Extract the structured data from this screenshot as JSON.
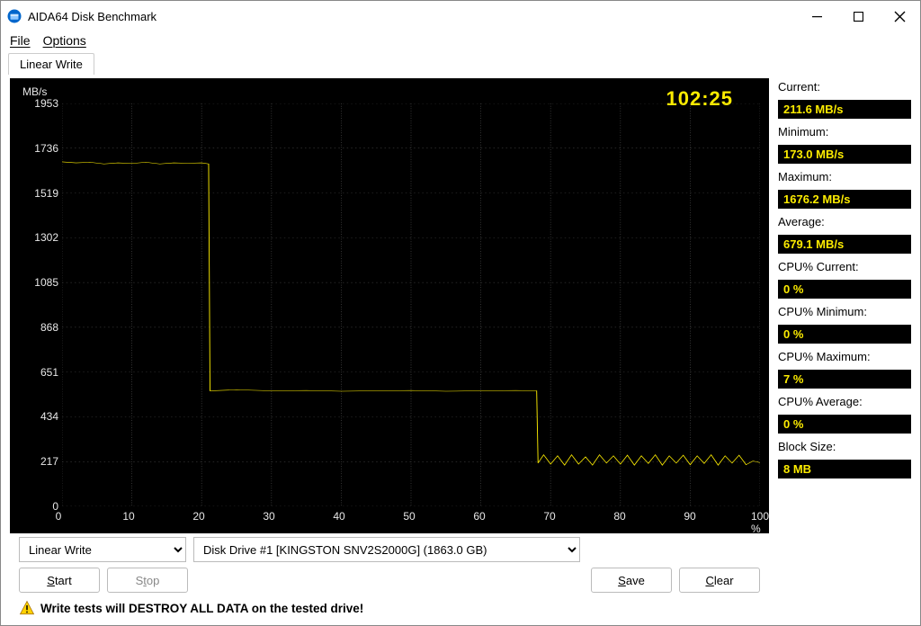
{
  "window": {
    "title": "AIDA64 Disk Benchmark"
  },
  "menu": {
    "file": "File",
    "options": "Options"
  },
  "tabs": {
    "active": "Linear Write"
  },
  "chart_data": {
    "type": "line",
    "ylabel": "MB/s",
    "xlabel_suffix": "%",
    "timer": "102:25",
    "y_ticks": [
      0,
      217,
      434,
      651,
      868,
      1085,
      1302,
      1519,
      1736,
      1953
    ],
    "x_ticks": [
      0,
      10,
      20,
      30,
      40,
      50,
      60,
      70,
      80,
      90,
      100
    ],
    "ylim": [
      0,
      1953
    ],
    "xlim": [
      0,
      100
    ],
    "series": [
      {
        "name": "write-speed",
        "data": [
          [
            0,
            1670
          ],
          [
            2,
            1665
          ],
          [
            4,
            1668
          ],
          [
            6,
            1660
          ],
          [
            8,
            1665
          ],
          [
            10,
            1662
          ],
          [
            12,
            1668
          ],
          [
            14,
            1660
          ],
          [
            16,
            1665
          ],
          [
            18,
            1663
          ],
          [
            20,
            1665
          ],
          [
            21,
            1660
          ],
          [
            21.2,
            560
          ],
          [
            25,
            565
          ],
          [
            30,
            560
          ],
          [
            35,
            562
          ],
          [
            40,
            558
          ],
          [
            45,
            560
          ],
          [
            50,
            562
          ],
          [
            55,
            558
          ],
          [
            60,
            560
          ],
          [
            65,
            562
          ],
          [
            68,
            560
          ],
          [
            68.2,
            210
          ],
          [
            69,
            250
          ],
          [
            70,
            205
          ],
          [
            71,
            245
          ],
          [
            72,
            200
          ],
          [
            73,
            250
          ],
          [
            74,
            205
          ],
          [
            75,
            240
          ],
          [
            76,
            200
          ],
          [
            77,
            250
          ],
          [
            78,
            210
          ],
          [
            79,
            245
          ],
          [
            80,
            205
          ],
          [
            81,
            248
          ],
          [
            82,
            200
          ],
          [
            83,
            245
          ],
          [
            84,
            208
          ],
          [
            85,
            250
          ],
          [
            86,
            200
          ],
          [
            87,
            245
          ],
          [
            88,
            210
          ],
          [
            89,
            248
          ],
          [
            90,
            202
          ],
          [
            91,
            245
          ],
          [
            92,
            208
          ],
          [
            93,
            250
          ],
          [
            94,
            200
          ],
          [
            95,
            245
          ],
          [
            96,
            210
          ],
          [
            97,
            248
          ],
          [
            98,
            202
          ],
          [
            99,
            220
          ],
          [
            100,
            212
          ]
        ]
      }
    ]
  },
  "stats": {
    "current_label": "Current:",
    "current_value": "211.6 MB/s",
    "minimum_label": "Minimum:",
    "minimum_value": "173.0 MB/s",
    "maximum_label": "Maximum:",
    "maximum_value": "1676.2 MB/s",
    "average_label": "Average:",
    "average_value": "679.1 MB/s",
    "cpu_current_label": "CPU% Current:",
    "cpu_current_value": "0 %",
    "cpu_minimum_label": "CPU% Minimum:",
    "cpu_minimum_value": "0 %",
    "cpu_maximum_label": "CPU% Maximum:",
    "cpu_maximum_value": "7 %",
    "cpu_average_label": "CPU% Average:",
    "cpu_average_value": "0 %",
    "block_size_label": "Block Size:",
    "block_size_value": "8 MB"
  },
  "controls": {
    "test_selected": "Linear Write",
    "drive_selected": "Disk Drive #1  [KINGSTON SNV2S2000G]  (1863.0 GB)"
  },
  "buttons": {
    "start": "Start",
    "stop": "Stop",
    "save": "Save",
    "clear": "Clear"
  },
  "warning": "Write tests will DESTROY ALL DATA on the tested drive!"
}
